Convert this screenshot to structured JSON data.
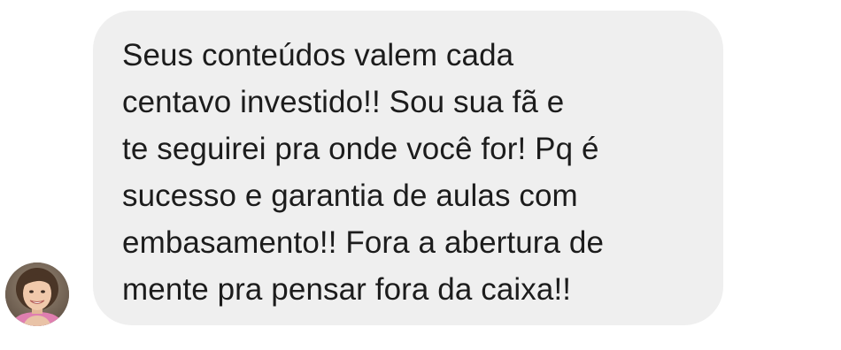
{
  "message": {
    "sender_avatar": "avatar-woman-icon",
    "text": "Seus conteúdos valem cada\ncentavo investido!!  Sou sua fã e\nte seguirei pra onde você for! Pq é\nsucesso e garantia de aulas com\nembasamento!! Fora a abertura de\nmente pra pensar fora da caixa!!"
  },
  "colors": {
    "bubble_background": "#efefef",
    "text": "#1c1c1c",
    "page_background": "#ffffff"
  }
}
